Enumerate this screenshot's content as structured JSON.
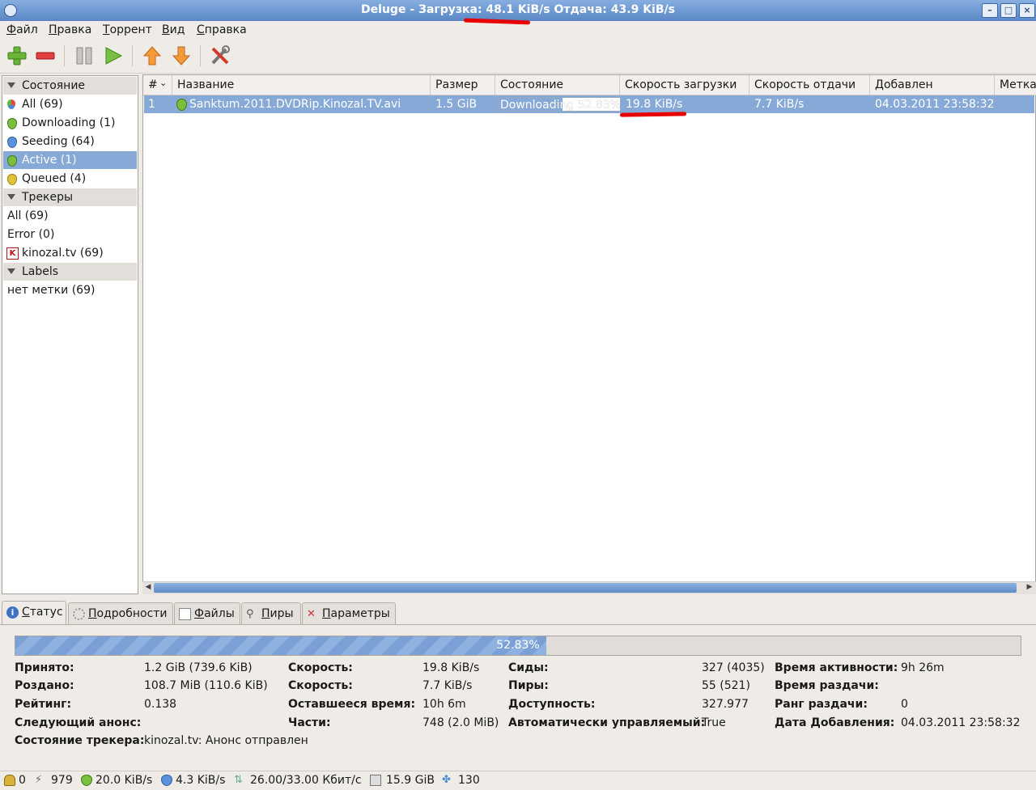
{
  "window": {
    "title": "Deluge - Загрузка: 48.1 KiB/s Отдача: 43.9 KiB/s"
  },
  "menu": [
    "Файл",
    "Правка",
    "Торрент",
    "Вид",
    "Справка"
  ],
  "toolbar": {
    "icons": [
      "add-torrent-icon",
      "remove-torrent-icon",
      "pause-icon",
      "resume-icon",
      "queue-up-icon",
      "queue-down-icon",
      "preferences-icon"
    ]
  },
  "sidebar": {
    "state_header": "Состояние",
    "state_items": [
      "All (69)",
      "Downloading (1)",
      "Seeding (64)",
      "Active (1)",
      "Queued (4)"
    ],
    "selected": "Active (1)",
    "trackers_header": "Трекеры",
    "tracker_items": [
      "All (69)",
      "Error (0)",
      "kinozal.tv (69)"
    ],
    "labels_header": "Labels",
    "label_items": [
      "нет метки (69)"
    ]
  },
  "torrent_list": {
    "columns": [
      "#",
      "Название",
      "Размер",
      "Состояние",
      "Скорость загрузки",
      "Скорость отдачи",
      "Добавлен",
      "Метка"
    ],
    "rows": [
      {
        "num": "1",
        "name": "Sanktum.2011.DVDRip.Kinozal.TV.avi",
        "size": "1.5 GiB",
        "state": "Downloading 52.83%",
        "progress": 0.5283,
        "down_speed": "19.8 KiB/s",
        "up_speed": "7.7 KiB/s",
        "added": "04.03.2011 23:58:32",
        "label": ""
      }
    ]
  },
  "tabs": [
    "Статус",
    "Подробности",
    "Файлы",
    "Пиры",
    "Параметры"
  ],
  "status_tab": {
    "progress_text": "52.83%",
    "progress": 0.5283,
    "fields": {
      "downloaded_label": "Принято:",
      "downloaded": "1.2 GiB (739.6 KiB)",
      "uploaded_label": "Роздано:",
      "uploaded": "108.7 MiB (110.6 KiB)",
      "ratio_label": "Рейтинг:",
      "ratio": "0.138",
      "next_announce_label": "Следующий анонс:",
      "next_announce": "",
      "tracker_status_label": "Состояние трекера:",
      "tracker_status": "kinozal.tv: Анонс отправлен",
      "down_speed_label": "Скорость:",
      "down_speed": "19.8 KiB/s",
      "up_speed_label": "Скорость:",
      "up_speed": "7.7 KiB/s",
      "eta_label": "Оставшееся время:",
      "eta": "10h 6m",
      "pieces_label": "Части:",
      "pieces": "748 (2.0 MiB)",
      "seeders_label": "Сиды:",
      "seeders": "327 (4035)",
      "peers_label": "Пиры:",
      "peers": "55 (521)",
      "availability_label": "Доступность:",
      "availability": "327.977",
      "auto_managed_label": "Автоматически управляемый:",
      "auto_managed": "True",
      "active_time_label": "Время активности:",
      "active_time": "9h 26m",
      "seeding_time_label": "Время раздачи:",
      "seeding_time": "",
      "seed_rank_label": "Ранг раздачи:",
      "seed_rank": "0",
      "date_added_label": "Дата Добавления:",
      "date_added": "04.03.2011 23:58:32"
    }
  },
  "statusbar": {
    "connections": "0",
    "peers": "979",
    "down": "20.0 KiB/s",
    "up": "4.3 KiB/s",
    "protocol": "26.00/33.00 Кбит/с",
    "disk_free": "15.9 GiB",
    "dht_nodes": "130"
  },
  "colors": {
    "selection": "#86a9d8",
    "title_gradient_top": "#86aee0",
    "annotation_red": "#e80000"
  }
}
